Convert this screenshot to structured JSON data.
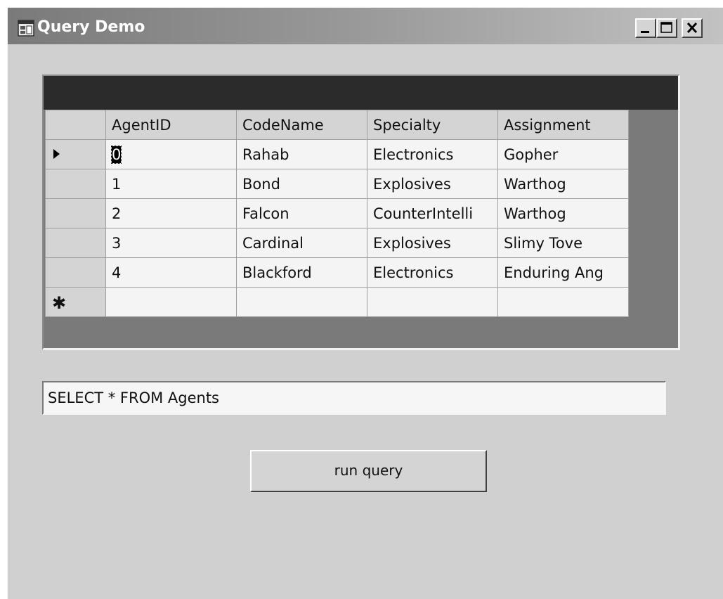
{
  "window": {
    "title": "Query Demo",
    "controls": {
      "minimize": "minimize",
      "maximize": "maximize",
      "close": "close"
    }
  },
  "grid": {
    "columns": [
      "AgentID",
      "CodeName",
      "Specialty",
      "Assignment"
    ],
    "rows": [
      [
        "0",
        "Rahab",
        "Electronics",
        "Gopher"
      ],
      [
        "1",
        "Bond",
        "Explosives",
        "Warthog"
      ],
      [
        "2",
        "Falcon",
        "CounterIntelli",
        "Warthog"
      ],
      [
        "3",
        "Cardinal",
        "Explosives",
        "Slimy Tove"
      ],
      [
        "4",
        "Blackford",
        "Electronics",
        "Enduring Ang"
      ]
    ],
    "selected_row_index": 0,
    "new_row_marker": "✱",
    "row_indicator_icon": "play-arrow-icon"
  },
  "query": {
    "value": "SELECT * FROM Agents"
  },
  "run_button": {
    "label": "run query"
  }
}
